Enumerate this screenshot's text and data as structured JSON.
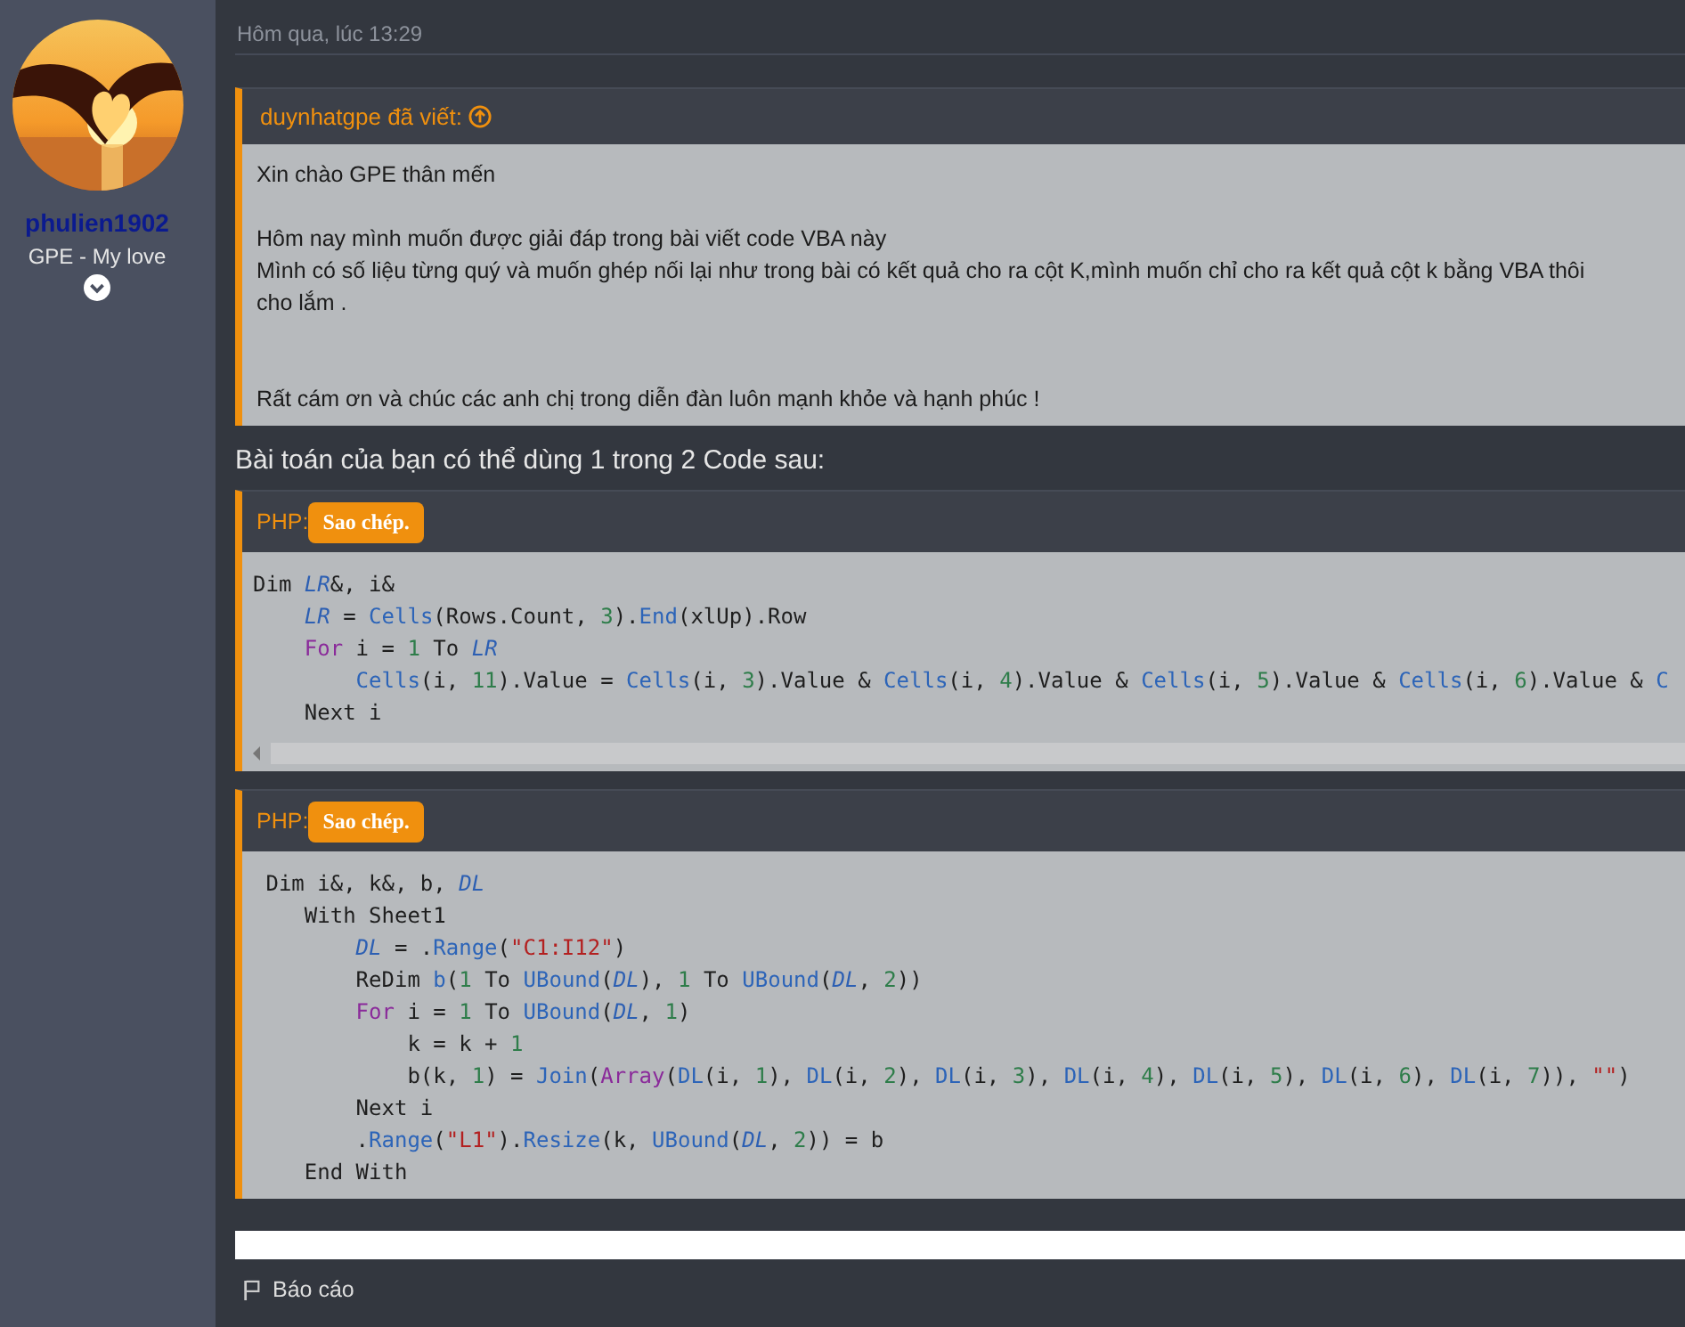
{
  "author": {
    "name": "phulien1902",
    "title": "GPE - My love"
  },
  "post": {
    "timestamp": "Hôm qua, lúc 13:29",
    "quote": {
      "header": "duynhatgpe đã viết:",
      "paragraphs": [
        [
          "Xin chào GPE thân mến"
        ],
        [
          "Hôm nay mình muốn được giải đáp trong bài viết code VBA này",
          "Mình có số liệu từng quý và muốn ghép nối lại như trong bài có kết quả cho ra cột K,mình muốn chỉ cho ra kết quả cột k bằng VBA thôi",
          "cho lắm ."
        ],
        [
          "Rất cám ơn và chúc các anh chị trong diễn đàn luôn mạnh khỏe và hạnh phúc !"
        ]
      ]
    },
    "reply_text": "Bài toán của bạn có thể dùng 1 trong 2 Code sau:",
    "code_blocks": [
      {
        "language": "PHP:",
        "copy_button": "Sao chép.",
        "scrollbar": true,
        "lines": [
          [
            {
              "text": "Dim ",
              "kind": "plain"
            },
            {
              "text": "LR",
              "kind": "var"
            },
            {
              "text": "&, i&",
              "kind": "plain"
            }
          ],
          [
            {
              "text": "    LR",
              "kind": "var"
            },
            {
              "text": " = ",
              "kind": "plain"
            },
            {
              "text": "Cells",
              "kind": "fn"
            },
            {
              "text": "(Rows.Count, ",
              "kind": "plain"
            },
            {
              "text": "3",
              "kind": "num"
            },
            {
              "text": ").",
              "kind": "plain"
            },
            {
              "text": "End",
              "kind": "fn"
            },
            {
              "text": "(xlUp).Row",
              "kind": "plain"
            }
          ],
          [
            {
              "text": "    For",
              "kind": "kw"
            },
            {
              "text": " i = ",
              "kind": "plain"
            },
            {
              "text": "1",
              "kind": "num"
            },
            {
              "text": " To ",
              "kind": "plain"
            },
            {
              "text": "LR",
              "kind": "var"
            }
          ],
          [
            {
              "text": "        Cells",
              "kind": "fn"
            },
            {
              "text": "(i, ",
              "kind": "plain"
            },
            {
              "text": "11",
              "kind": "num"
            },
            {
              "text": ").Value = ",
              "kind": "plain"
            },
            {
              "text": "Cells",
              "kind": "fn"
            },
            {
              "text": "(i, ",
              "kind": "plain"
            },
            {
              "text": "3",
              "kind": "num"
            },
            {
              "text": ").Value & ",
              "kind": "plain"
            },
            {
              "text": "Cells",
              "kind": "fn"
            },
            {
              "text": "(i, ",
              "kind": "plain"
            },
            {
              "text": "4",
              "kind": "num"
            },
            {
              "text": ").Value & ",
              "kind": "plain"
            },
            {
              "text": "Cells",
              "kind": "fn"
            },
            {
              "text": "(i, ",
              "kind": "plain"
            },
            {
              "text": "5",
              "kind": "num"
            },
            {
              "text": ").Value & ",
              "kind": "plain"
            },
            {
              "text": "Cells",
              "kind": "fn"
            },
            {
              "text": "(i, ",
              "kind": "plain"
            },
            {
              "text": "6",
              "kind": "num"
            },
            {
              "text": ").Value & ",
              "kind": "plain"
            },
            {
              "text": "C",
              "kind": "fn"
            }
          ],
          [
            {
              "text": "    Next i",
              "kind": "plain"
            }
          ]
        ]
      },
      {
        "language": "PHP:",
        "copy_button": "Sao chép.",
        "scrollbar": false,
        "lines": [
          [
            {
              "text": " Dim i&, k&, b, ",
              "kind": "plain"
            },
            {
              "text": "DL",
              "kind": "var"
            }
          ],
          [
            {
              "text": "    With Sheet1",
              "kind": "plain"
            }
          ],
          [
            {
              "text": "        DL",
              "kind": "var"
            },
            {
              "text": " = .",
              "kind": "plain"
            },
            {
              "text": "Range",
              "kind": "fn"
            },
            {
              "text": "(",
              "kind": "plain"
            },
            {
              "text": "\"C1:I12\"",
              "kind": "str"
            },
            {
              "text": ")",
              "kind": "plain"
            }
          ],
          [
            {
              "text": "        ReDim ",
              "kind": "plain"
            },
            {
              "text": "b",
              "kind": "fn"
            },
            {
              "text": "(",
              "kind": "plain"
            },
            {
              "text": "1",
              "kind": "num"
            },
            {
              "text": " To ",
              "kind": "plain"
            },
            {
              "text": "UBound",
              "kind": "fn"
            },
            {
              "text": "(",
              "kind": "plain"
            },
            {
              "text": "DL",
              "kind": "var"
            },
            {
              "text": "), ",
              "kind": "plain"
            },
            {
              "text": "1",
              "kind": "num"
            },
            {
              "text": " To ",
              "kind": "plain"
            },
            {
              "text": "UBound",
              "kind": "fn"
            },
            {
              "text": "(",
              "kind": "plain"
            },
            {
              "text": "DL",
              "kind": "var"
            },
            {
              "text": ", ",
              "kind": "plain"
            },
            {
              "text": "2",
              "kind": "num"
            },
            {
              "text": "))",
              "kind": "plain"
            }
          ],
          [
            {
              "text": "        For",
              "kind": "kw"
            },
            {
              "text": " i = ",
              "kind": "plain"
            },
            {
              "text": "1",
              "kind": "num"
            },
            {
              "text": " To ",
              "kind": "plain"
            },
            {
              "text": "UBound",
              "kind": "fn"
            },
            {
              "text": "(",
              "kind": "plain"
            },
            {
              "text": "DL",
              "kind": "var"
            },
            {
              "text": ", ",
              "kind": "plain"
            },
            {
              "text": "1",
              "kind": "num"
            },
            {
              "text": ")",
              "kind": "plain"
            }
          ],
          [
            {
              "text": "            k = k + ",
              "kind": "plain"
            },
            {
              "text": "1",
              "kind": "num"
            }
          ],
          [
            {
              "text": "            b(k, ",
              "kind": "plain"
            },
            {
              "text": "1",
              "kind": "num"
            },
            {
              "text": ") = ",
              "kind": "plain"
            },
            {
              "text": "Join",
              "kind": "fn"
            },
            {
              "text": "(",
              "kind": "plain"
            },
            {
              "text": "Array",
              "kind": "kw"
            },
            {
              "text": "(",
              "kind": "plain"
            },
            {
              "text": "DL",
              "kind": "fn"
            },
            {
              "text": "(i, ",
              "kind": "plain"
            },
            {
              "text": "1",
              "kind": "num"
            },
            {
              "text": "), ",
              "kind": "plain"
            },
            {
              "text": "DL",
              "kind": "fn"
            },
            {
              "text": "(i, ",
              "kind": "plain"
            },
            {
              "text": "2",
              "kind": "num"
            },
            {
              "text": "), ",
              "kind": "plain"
            },
            {
              "text": "DL",
              "kind": "fn"
            },
            {
              "text": "(i, ",
              "kind": "plain"
            },
            {
              "text": "3",
              "kind": "num"
            },
            {
              "text": "), ",
              "kind": "plain"
            },
            {
              "text": "DL",
              "kind": "fn"
            },
            {
              "text": "(i, ",
              "kind": "plain"
            },
            {
              "text": "4",
              "kind": "num"
            },
            {
              "text": "), ",
              "kind": "plain"
            },
            {
              "text": "DL",
              "kind": "fn"
            },
            {
              "text": "(i, ",
              "kind": "plain"
            },
            {
              "text": "5",
              "kind": "num"
            },
            {
              "text": "), ",
              "kind": "plain"
            },
            {
              "text": "DL",
              "kind": "fn"
            },
            {
              "text": "(i, ",
              "kind": "plain"
            },
            {
              "text": "6",
              "kind": "num"
            },
            {
              "text": "), ",
              "kind": "plain"
            },
            {
              "text": "DL",
              "kind": "fn"
            },
            {
              "text": "(i, ",
              "kind": "plain"
            },
            {
              "text": "7",
              "kind": "num"
            },
            {
              "text": ")), ",
              "kind": "plain"
            },
            {
              "text": "\"\"",
              "kind": "str"
            },
            {
              "text": ")",
              "kind": "plain"
            }
          ],
          [
            {
              "text": "        Next i",
              "kind": "plain"
            }
          ],
          [
            {
              "text": "        .",
              "kind": "plain"
            },
            {
              "text": "Range",
              "kind": "fn"
            },
            {
              "text": "(",
              "kind": "plain"
            },
            {
              "text": "\"L1\"",
              "kind": "str"
            },
            {
              "text": ").",
              "kind": "plain"
            },
            {
              "text": "Resize",
              "kind": "fn"
            },
            {
              "text": "(k, ",
              "kind": "plain"
            },
            {
              "text": "UBound",
              "kind": "fn"
            },
            {
              "text": "(",
              "kind": "plain"
            },
            {
              "text": "DL",
              "kind": "var"
            },
            {
              "text": ", ",
              "kind": "plain"
            },
            {
              "text": "2",
              "kind": "num"
            },
            {
              "text": ")) = b",
              "kind": "plain"
            }
          ],
          [
            {
              "text": "    End With",
              "kind": "plain"
            }
          ]
        ]
      }
    ],
    "footer": {
      "report_link": "Báo cáo"
    }
  }
}
